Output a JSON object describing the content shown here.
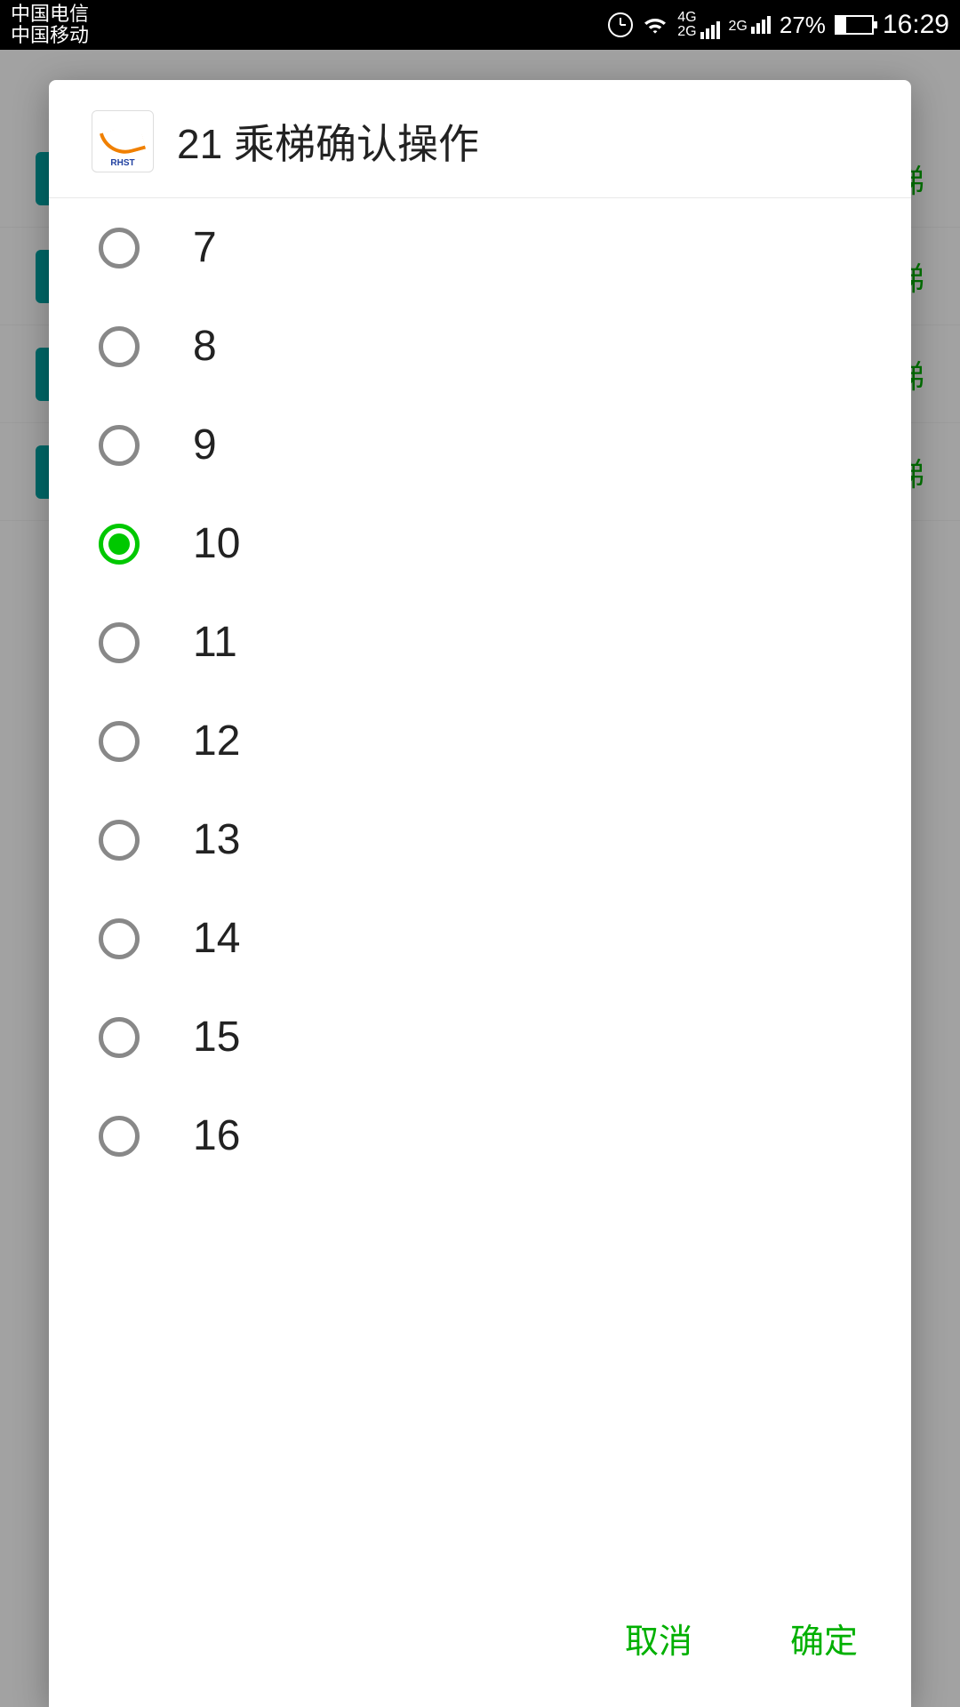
{
  "status": {
    "carrier1": "中国电信",
    "carrier2": "中国移动",
    "net1": "4G",
    "net1b": "2G",
    "net2": "2G",
    "battery_pct": "27%",
    "time": "16:29"
  },
  "background": {
    "label": "梯"
  },
  "dialog": {
    "icon_text": "RHST",
    "title": "21 乘梯确认操作",
    "options": [
      {
        "label": "7",
        "selected": false
      },
      {
        "label": "8",
        "selected": false
      },
      {
        "label": "9",
        "selected": false
      },
      {
        "label": "10",
        "selected": true
      },
      {
        "label": "11",
        "selected": false
      },
      {
        "label": "12",
        "selected": false
      },
      {
        "label": "13",
        "selected": false
      },
      {
        "label": "14",
        "selected": false
      },
      {
        "label": "15",
        "selected": false
      },
      {
        "label": "16",
        "selected": false
      }
    ],
    "cancel": "取消",
    "confirm": "确定"
  }
}
